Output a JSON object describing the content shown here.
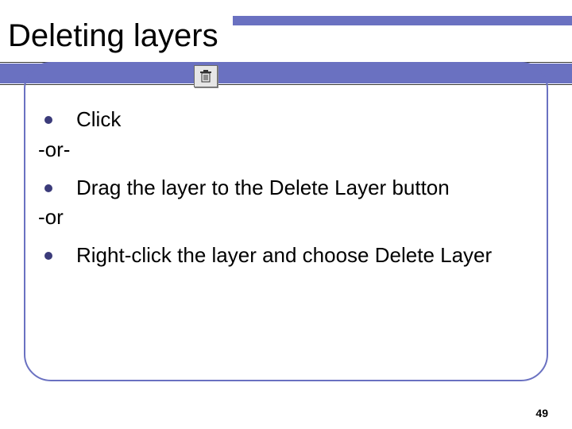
{
  "title": "Deleting layers",
  "icon": {
    "name": "trash-icon"
  },
  "items": [
    {
      "kind": "bullet",
      "text": "Click"
    },
    {
      "kind": "or",
      "text": "-or-"
    },
    {
      "kind": "bullet",
      "text": "Drag the layer to the Delete Layer button"
    },
    {
      "kind": "or",
      "text": "-or"
    },
    {
      "kind": "bullet",
      "text": "Right-click the layer and choose Delete Layer"
    }
  ],
  "page_number": "49",
  "colors": {
    "accent": "#6a71c1"
  }
}
